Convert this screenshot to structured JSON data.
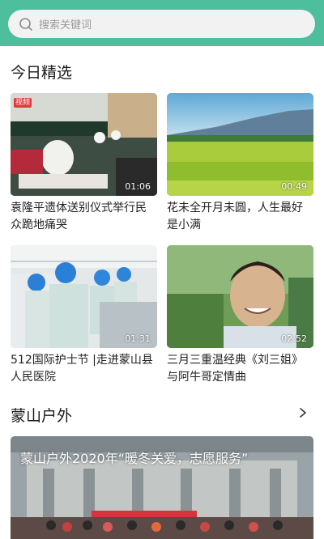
{
  "search": {
    "placeholder": "搜索关键词"
  },
  "sections": {
    "today": {
      "title": "今日精选"
    },
    "outdoor": {
      "title": "蒙山户外"
    }
  },
  "videos": [
    {
      "title": "袁隆平遗体送别仪式举行民众跪地痛哭",
      "duration": "01:06",
      "badge": "视频"
    },
    {
      "title": "花未全开月未圆，人生最好是小满",
      "duration": "00:49"
    },
    {
      "title": "512国际护士节 |走进蒙山县人民医院",
      "duration": "01:31"
    },
    {
      "title": "三月三重温经典《刘三姐》与阿牛哥定情曲",
      "duration": "02:52"
    }
  ],
  "banner": {
    "title": "蒙山户外2020年“暖冬关爱，志愿服务”"
  },
  "colors": {
    "topbar": "#4dbf9c",
    "search_bg": "#f2f2f2"
  }
}
